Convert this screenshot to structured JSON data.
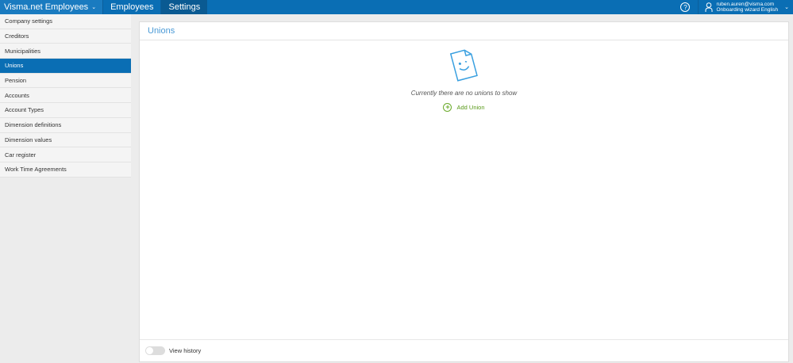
{
  "topbar": {
    "brand": "Visma.net Employees",
    "tabs": [
      "Employees",
      "Settings"
    ],
    "active_tab": "Settings",
    "help": "?",
    "user_email": "ruben.auren@visma.com",
    "user_context": "Onboarding wizard English"
  },
  "sidebar": {
    "items": [
      "Company settings",
      "Creditors",
      "Municipalities",
      "Unions",
      "Pension",
      "Accounts",
      "Account Types",
      "Dimension definitions",
      "Dimension values",
      "Car register",
      "Work Time Agreements"
    ],
    "active": "Unions"
  },
  "main": {
    "title": "Unions",
    "empty_message": "Currently there are no unions to show",
    "add_label": "Add Union",
    "history_label": "View history",
    "history_on": false
  }
}
